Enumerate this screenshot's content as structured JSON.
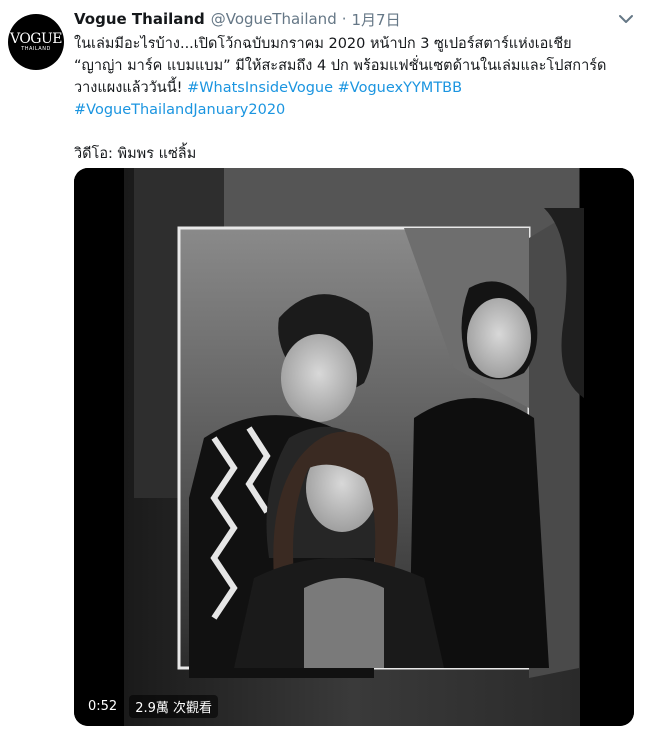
{
  "tweet": {
    "avatar": {
      "logo": "VOGUE",
      "sub": "THAILAND"
    },
    "author_name": "Vogue Thailand",
    "author_handle": "@VogueThailand",
    "separator": "·",
    "date": "1月7日",
    "text": {
      "line1": "ในเล่มมีอะไรบ้าง...เปิดโว้กฉบับมกราคม 2020 หน้าปก 3 ซูเปอร์สตาร์แห่งเอเชีย",
      "line2": "“ญาญ่า มาร์ค แบมแบม” มีให้สะสมถึง 4 ปก พร้อมแฟชั่นเซตด้านในเล่มและโปสการ์ด",
      "line3_text": "วางแผงแล้ววันนี้!",
      "line3_tag1": "#WhatsInsideVogue",
      "line3_tag2": "#VoguexYYMTBB",
      "line4_tag": "#VogueThailandJanuary2020",
      "credit": "วิดีโอ: พิมพร แซ่ลิ้ม"
    },
    "video": {
      "duration": "0:52",
      "views": "2.9萬 次觀看"
    }
  },
  "colors": {
    "link": "#1b95e0",
    "secondary_text": "#657786",
    "primary_text": "#14171a"
  },
  "icons": {
    "menu": "chevron-down-icon"
  }
}
